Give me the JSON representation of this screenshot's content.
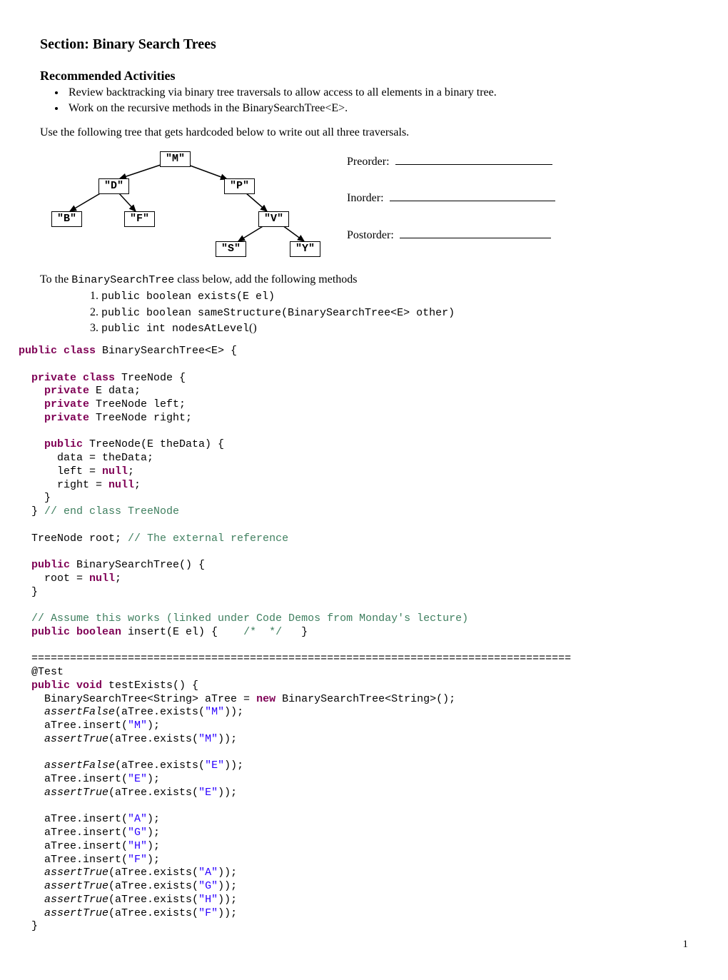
{
  "heading": "Section: Binary Search Trees",
  "subheading": "Recommended Activities",
  "activities": [
    "Review backtracking via binary tree traversals to allow access to all elements in a binary tree.",
    "Work on the recursive methods in the BinarySearchTree<E>."
  ],
  "tree_intro": "Use the following tree that gets hardcoded below to write out all three traversals.",
  "tree": {
    "nodes": {
      "M": "\"M\"",
      "D": "\"D\"",
      "P": "\"P\"",
      "B": "\"B\"",
      "F": "\"F\"",
      "V": "\"V\"",
      "S": "\"S\"",
      "Y": "\"Y\""
    }
  },
  "traversals": {
    "preorder": "Preorder:",
    "inorder": "Inorder:",
    "postorder": "Postorder:"
  },
  "methods_intro_1": "To the ",
  "methods_intro_class": "BinarySearchTree",
  "methods_intro_2": " class below, add the following methods",
  "methods": [
    {
      "sig": "public boolean exists(E el)"
    },
    {
      "sig": "public boolean sameStructure(BinarySearchTree<E> other)"
    },
    {
      "prefix": "public int nodesAtLevel",
      "suffix": "()"
    }
  ],
  "code": {
    "l01a": "public class",
    "l01b": " BinarySearchTree<E> {",
    "l02": "",
    "l03a": "  private class",
    "l03b": " TreeNode {",
    "l04a": "    private",
    "l04b": " E data;",
    "l05a": "    private",
    "l05b": " TreeNode left;",
    "l06a": "    private",
    "l06b": " TreeNode right;",
    "l07": "",
    "l08a": "    public",
    "l08b": " TreeNode(E theData) {",
    "l09": "      data = theData;",
    "l10a": "      left = ",
    "l10b": "null",
    "l10c": ";",
    "l11a": "      right = ",
    "l11b": "null",
    "l11c": ";",
    "l12": "    }",
    "l13a": "  } ",
    "l13b": "// end class TreeNode",
    "l14": "",
    "l15a": "  TreeNode root; ",
    "l15b": "// The external reference",
    "l16": "",
    "l17a": "  public",
    "l17b": " BinarySearchTree() {",
    "l18a": "    root = ",
    "l18b": "null",
    "l18c": ";",
    "l19": "  }",
    "l20": "",
    "l21": "  // Assume this works (linked under Code Demos from Monday's lecture)",
    "l22a": "  public boolean",
    "l22b": " insert(E el) {    ",
    "l22c": "/*  */",
    "l22d": "   }",
    "l23": "",
    "l24": "  ====================================================================================",
    "l25": "  @Test",
    "l26a": "  public void",
    "l26b": " testExists() {",
    "l27a": "    BinarySearchTree<String> aTree = ",
    "l27b": "new",
    "l27c": " BinarySearchTree<String>();",
    "l28a": "    assertFalse",
    "l28b": "(aTree.exists(",
    "l28c": "\"M\"",
    "l28d": "));",
    "l29a": "    aTree.insert(",
    "l29b": "\"M\"",
    "l29c": ");",
    "l30a": "    assertTrue",
    "l30b": "(aTree.exists(",
    "l30c": "\"M\"",
    "l30d": "));",
    "l31": "",
    "l32a": "    assertFalse",
    "l32b": "(aTree.exists(",
    "l32c": "\"E\"",
    "l32d": "));",
    "l33a": "    aTree.insert(",
    "l33b": "\"E\"",
    "l33c": ");",
    "l34a": "    assertTrue",
    "l34b": "(aTree.exists(",
    "l34c": "\"E\"",
    "l34d": "));",
    "l35": "",
    "l36a": "    aTree.insert(",
    "l36b": "\"A\"",
    "l36c": ");",
    "l37a": "    aTree.insert(",
    "l37b": "\"G\"",
    "l37c": ");",
    "l38a": "    aTree.insert(",
    "l38b": "\"H\"",
    "l38c": ");",
    "l39a": "    aTree.insert(",
    "l39b": "\"F\"",
    "l39c": ");",
    "l40a": "    assertTrue",
    "l40b": "(aTree.exists(",
    "l40c": "\"A\"",
    "l40d": "));",
    "l41a": "    assertTrue",
    "l41b": "(aTree.exists(",
    "l41c": "\"G\"",
    "l41d": "));",
    "l42a": "    assertTrue",
    "l42b": "(aTree.exists(",
    "l42c": "\"H\"",
    "l42d": "));",
    "l43a": "    assertTrue",
    "l43b": "(aTree.exists(",
    "l43c": "\"F\"",
    "l43d": "));",
    "l44": "  }"
  },
  "pagenum": "1"
}
